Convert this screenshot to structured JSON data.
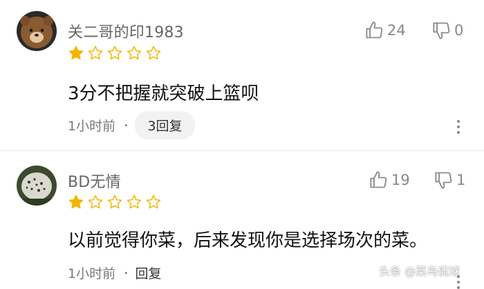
{
  "comments": [
    {
      "username": "关二哥的印1983",
      "rating": 1,
      "rating_max": 5,
      "text": "3分不把握就突破上篮呗",
      "time": "1小时前",
      "reply_label": "3回复",
      "likes": "24",
      "dislikes": "0"
    },
    {
      "username": "BD无情",
      "rating": 1,
      "rating_max": 5,
      "text": "以前觉得你菜，后来发现你是选择场次的菜。",
      "time": "1小时前",
      "reply_label": "回复",
      "likes": "19",
      "dislikes": "1"
    }
  ],
  "watermark": "头条 @菜鸟侃球",
  "colors": {
    "star": "#f5b400",
    "icon": "#8a8a8a",
    "pill": "#f2f2f2"
  },
  "icons": {
    "like": "thumbs-up-icon",
    "dislike": "thumbs-down-icon",
    "more": "more-vertical-icon"
  }
}
